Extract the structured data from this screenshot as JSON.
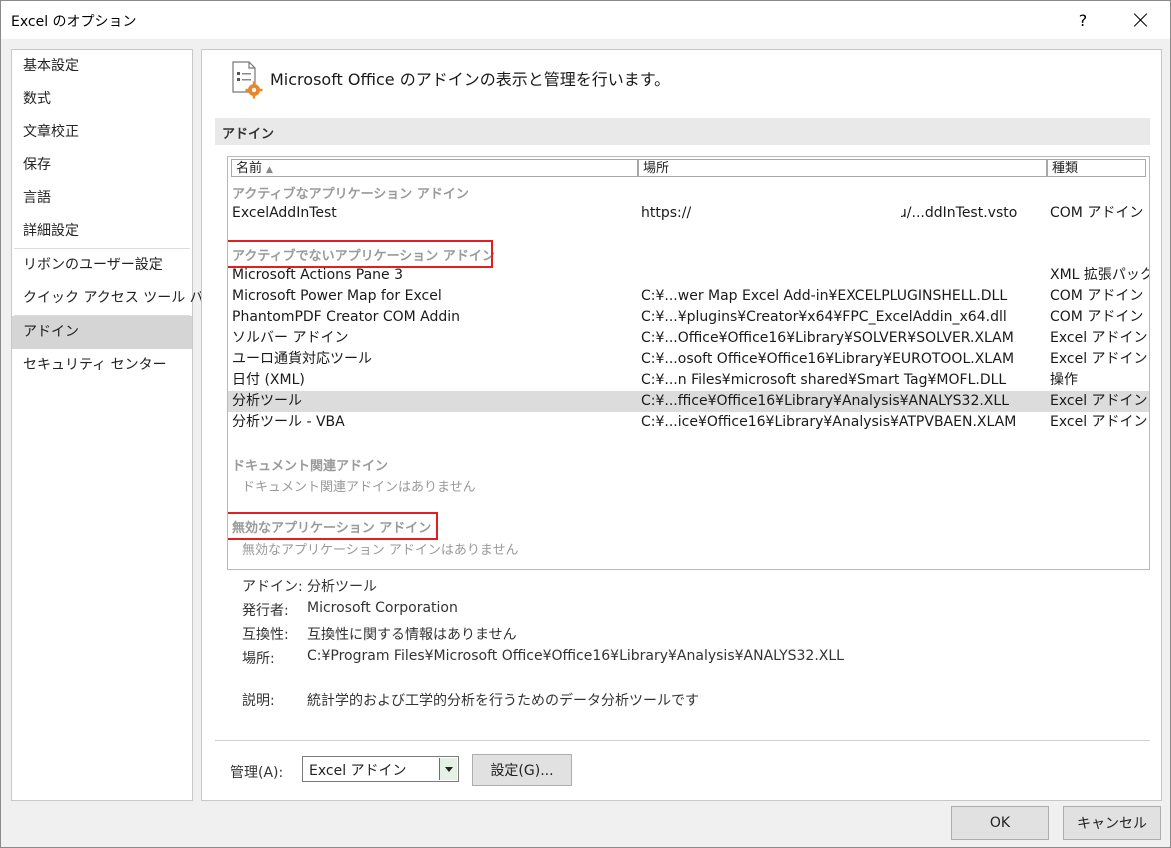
{
  "window": {
    "title": "Excel のオプション",
    "help_label": "?"
  },
  "sidebar": {
    "items": [
      {
        "label": "基本設定"
      },
      {
        "label": "数式"
      },
      {
        "label": "文章校正"
      },
      {
        "label": "保存"
      },
      {
        "label": "言語"
      },
      {
        "label": "詳細設定"
      },
      {
        "label": "リボンのユーザー設定"
      },
      {
        "label": "クイック アクセス ツール バー"
      },
      {
        "label": "アドイン"
      },
      {
        "label": "セキュリティ センター"
      }
    ],
    "selected": "アドイン"
  },
  "main": {
    "title": "Microsoft Office のアドインの表示と管理を行います。",
    "section_label": "アドイン"
  },
  "table": {
    "headers": {
      "name": "名前",
      "sort_indicator": "▲",
      "location": "場所",
      "type": "種類"
    },
    "active_group": {
      "title": "アクティブなアプリケーション アドイン",
      "rows": [
        {
          "name": "ExcelAddInTest",
          "location": "https://",
          "location_tail": "ɹ/...ddInTest.vsto",
          "type": "COM アドイン"
        }
      ]
    },
    "inactive_group": {
      "title": "アクティブでないアプリケーション アドイン",
      "rows": [
        {
          "name": "Microsoft Actions Pane 3",
          "location": "",
          "type": "XML 拡張パック"
        },
        {
          "name": "Microsoft Power Map for Excel",
          "location": "C:¥...wer Map Excel Add-in¥EXCELPLUGINSHELL.DLL",
          "type": "COM アドイン"
        },
        {
          "name": "PhantomPDF Creator COM Addin",
          "location": "C:¥...¥plugins¥Creator¥x64¥FPC_ExcelAddin_x64.dll",
          "type": "COM アドイン"
        },
        {
          "name": "ソルバー アドイン",
          "location": "C:¥...Office¥Office16¥Library¥SOLVER¥SOLVER.XLAM",
          "type": "Excel アドイン"
        },
        {
          "name": "ユーロ通貨対応ツール",
          "location": "C:¥...osoft Office¥Office16¥Library¥EUROTOOL.XLAM",
          "type": "Excel アドイン"
        },
        {
          "name": "日付 (XML)",
          "location": "C:¥...n Files¥microsoft shared¥Smart Tag¥MOFL.DLL",
          "type": "操作"
        },
        {
          "name": "分析ツール",
          "location": "C:¥...ffice¥Office16¥Library¥Analysis¥ANALYS32.XLL",
          "type": "Excel アドイン",
          "selected": true
        },
        {
          "name": "分析ツール - VBA",
          "location": "C:¥...ice¥Office16¥Library¥Analysis¥ATPVBAEN.XLAM",
          "type": "Excel アドイン"
        }
      ]
    },
    "document_group": {
      "title": "ドキュメント関連アドイン",
      "empty_note": "ドキュメント関連アドインはありません"
    },
    "disabled_group": {
      "title": "無効なアプリケーション アドイン",
      "empty_note": "無効なアプリケーション アドインはありません"
    }
  },
  "details": {
    "addin": {
      "label": "アドイン:",
      "value": "分析ツール"
    },
    "publisher": {
      "label": "発行者:",
      "value": "Microsoft Corporation"
    },
    "compat": {
      "label": "互換性:",
      "value": "互換性に関する情報はありません"
    },
    "location": {
      "label": "場所:",
      "value": "C:¥Program Files¥Microsoft Office¥Office16¥Library¥Analysis¥ANALYS32.XLL"
    },
    "description": {
      "label": "説明:",
      "value": "統計学的および工学的分析を行うためのデータ分析ツールです"
    }
  },
  "footer": {
    "manage_label": "管理(A):",
    "manage_value": "Excel アドイン",
    "settings_button": "設定(G)...",
    "ok_button": "OK",
    "cancel_button": "キャンセル"
  },
  "colors": {
    "highlight_box": "#e02020",
    "selected_row": "#dcdcdc",
    "sidebar_selected": "#d5d5d5"
  }
}
